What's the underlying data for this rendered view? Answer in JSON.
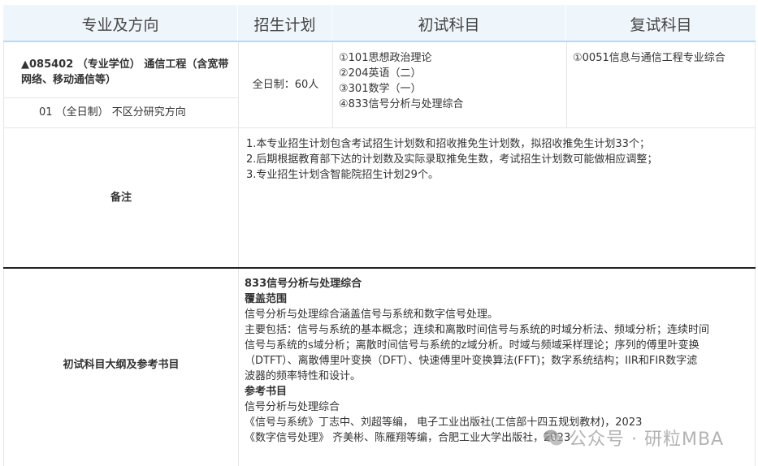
{
  "header": {
    "col1": "专业及方向",
    "col2": "招生计划",
    "col3": "初试科目",
    "col4": "复试科目"
  },
  "program": {
    "title": "▲085402 （专业学位） 通信工程（含宽带网络、移动通信等）",
    "direction": "01 （全日制） 不区分研究方向",
    "plan": "全日制：60人",
    "exam_subjects": [
      "①101思想政治理论",
      "②204英语（二）",
      "③301数学（一）",
      "④833信号分析与处理综合"
    ],
    "retest_subjects": [
      "①0051信息与通信工程专业综合"
    ]
  },
  "remarks": {
    "label": "备注",
    "lines": [
      "1.本专业招生计划包含考试招生计划数和招收推免生计划数，拟招收推免生计划33个；",
      "2.后期根据教育部下达的计划数及实际录取推免生数，考试招生计划数可能做相应调整；",
      "3.专业招生计划含智能院招生计划29个。"
    ]
  },
  "outline": {
    "label": "初试科目大纲及参考书目",
    "subject": "833信号分析与处理综合",
    "scope_heading": "覆盖范围",
    "scope_intro": "信号分析与处理综合涵盖信号与系统和数字信号处理。",
    "scope_detail": [
      "主要包括：信号与系统的基本概念；连续和离散时间信号与系统的时域分析法、频域分析；连续时间",
      "信号与系统的s域分析；离散时间信号与系统的z域分析。时域与频域采样理论；序列的傅里叶变换",
      "（DTFT）、离散傅里叶变换（DFT）、快速傅里叶变换算法(FFT)；数字系统结构；IIR和FIR数字滤",
      "波器的频率特性和设计。"
    ],
    "books_heading": "参考书目",
    "books_intro": "信号分析与处理综合",
    "books": [
      "《信号与系统》丁志中、刘超等编， 电子工业出版社(工信部十四五规划教材)，2023",
      "《数字信号处理》 齐美彬、陈雁翔等编，合肥工业大学出版社，2023"
    ]
  },
  "watermark": "公众号 · 研粒MBA"
}
